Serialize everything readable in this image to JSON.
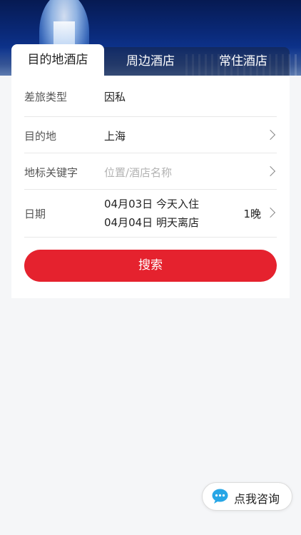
{
  "tabs": [
    {
      "label": "目的地酒店",
      "active": true
    },
    {
      "label": "周边酒店",
      "active": false
    },
    {
      "label": "常住酒店",
      "active": false
    }
  ],
  "form": {
    "travel_type": {
      "label": "差旅类型",
      "value": "因私"
    },
    "destination": {
      "label": "目的地",
      "value": "上海"
    },
    "keyword": {
      "label": "地标关键字",
      "placeholder": "位置/酒店名称"
    },
    "date": {
      "label": "日期",
      "checkin": "04月03日 今天入住",
      "checkout": "04月04日 明天离店",
      "nights": "1晚"
    }
  },
  "search_button": {
    "label": "搜索"
  },
  "consult_button": {
    "label": "点我咨询"
  },
  "colors": {
    "accent": "#e5222e",
    "consult_icon": "#27a6e6"
  }
}
